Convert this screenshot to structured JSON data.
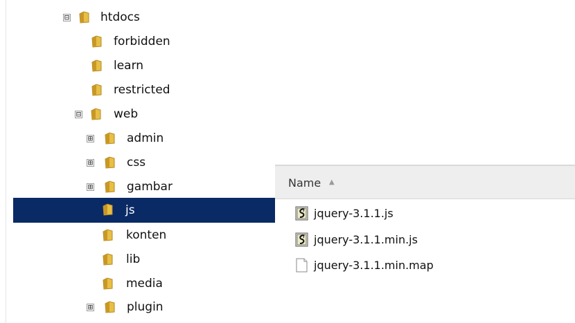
{
  "tree": {
    "items": [
      {
        "label": "htdocs",
        "expander": "⊟",
        "selected": false
      },
      {
        "label": "forbidden",
        "expander": "",
        "selected": false
      },
      {
        "label": "learn",
        "expander": "",
        "selected": false
      },
      {
        "label": "restricted",
        "expander": "",
        "selected": false
      },
      {
        "label": "web",
        "expander": "⊟",
        "selected": false
      },
      {
        "label": "admin",
        "expander": "⊞",
        "selected": false
      },
      {
        "label": "css",
        "expander": "⊞",
        "selected": false
      },
      {
        "label": "gambar",
        "expander": "⊞",
        "selected": false
      },
      {
        "label": "js",
        "expander": "",
        "selected": true
      },
      {
        "label": "konten",
        "expander": "",
        "selected": false
      },
      {
        "label": "lib",
        "expander": "",
        "selected": false
      },
      {
        "label": "media",
        "expander": "",
        "selected": false
      },
      {
        "label": "plugin",
        "expander": "⊞",
        "selected": false
      }
    ]
  },
  "file_list": {
    "header": "Name",
    "sort_icon": "up-sort-icon",
    "files": [
      {
        "name": "jquery-3.1.1.js",
        "icon": "script-file-icon"
      },
      {
        "name": "jquery-3.1.1.min.js",
        "icon": "script-file-icon"
      },
      {
        "name": "jquery-3.1.1.min.map",
        "icon": "blank-file-icon"
      }
    ]
  },
  "colors": {
    "selection": "#0a2a66",
    "folder": "#e8bf45"
  }
}
